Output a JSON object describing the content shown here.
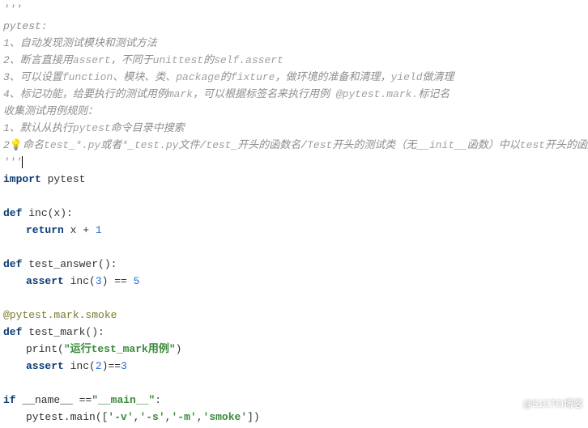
{
  "docstring": {
    "open": "'''",
    "title": "pytest:",
    "l1": "1、自动发现测试模块和测试方法",
    "l2a": "2、断言直接用",
    "l2b": "assert",
    "l2c": "，不同于",
    "l2d": "unittest",
    "l2e": "的",
    "l2f": "self.assert",
    "l3a": "3、可以设置",
    "l3b": "function",
    "l3c": "、模块、类、",
    "l3d": "package",
    "l3e": "的",
    "l3f": "fixture",
    "l3g": "，做环境的准备和清理，",
    "l3h": "yield",
    "l3i": "做清理",
    "l4a": "4、标记功能，给要执行的测试用例",
    "l4b": "mark",
    "l4c": "，可以根据标签名来执行用例 ",
    "l4d": "@pytest.mark.",
    "l4e": "标记名",
    "l5": "收集测试用例规则：",
    "l6a": "1、默认从执行",
    "l6b": "pytest",
    "l6c": "命令目录中搜索",
    "l7a": "2",
    "l7b": "命名",
    "l7c": "test_*.py",
    "l7d": "或者",
    "l7e": "*_test.py",
    "l7f": "文件/",
    "l7g": "test_",
    "l7h": "开头的函数名/",
    "l7i": "Test",
    "l7j": "开头的测试类（无",
    "l7k": "__init__",
    "l7l": "函数）中以",
    "l7m": "test",
    "l7n": "开头的函数名",
    "close": "'''"
  },
  "code": {
    "import_kw": "import ",
    "import_mod": "pytest",
    "def_kw": "def ",
    "inc_sig": "inc(x):",
    "ret_kw": "return ",
    "ret_expr1": "x + ",
    "ret_num": "1",
    "ta_sig": "test_answer():",
    "assert_kw": "assert ",
    "ta_body1": "inc(",
    "ta_num1": "3",
    "ta_body2": ") == ",
    "ta_num2": "5",
    "deco": "@pytest.mark.smoke",
    "tm_sig": "test_mark():",
    "print_call": "print(",
    "print_str": "\"运行test_mark用例\"",
    "print_close": ")",
    "tm_assert_body": "inc(",
    "tm_num1": "2",
    "tm_assert_mid": ")==",
    "tm_num2": "3",
    "if_kw": "if ",
    "name_var": "__name__ ==",
    "main_str": "\"__main__\"",
    "colon": ":",
    "main_call1": "pytest.main([",
    "arg1": "'-v'",
    "comma": ",",
    "arg2": "'-s'",
    "arg3": "'-m'",
    "arg4": "'smoke'",
    "main_call2": "])"
  },
  "watermark": "@51CTO博客"
}
